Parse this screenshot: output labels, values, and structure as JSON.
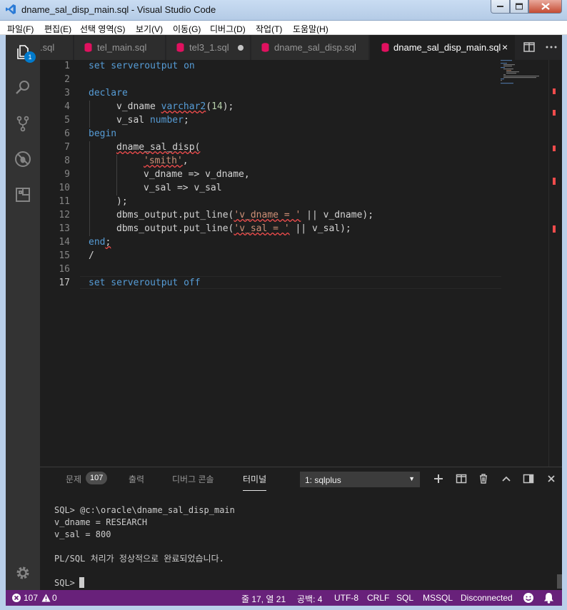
{
  "window": {
    "title": "dname_sal_disp_main.sql - Visual Studio Code"
  },
  "menu": [
    "파일(F)",
    "편집(E)",
    "선택 영역(S)",
    "보기(V)",
    "이동(G)",
    "디버그(D)",
    "작업(T)",
    "도움말(H)"
  ],
  "activity": {
    "explorer_badge": "1"
  },
  "tabs": [
    {
      "label": ".sql"
    },
    {
      "label": "tel_main.sql"
    },
    {
      "label": "tel3_1.sql",
      "dirty": true
    },
    {
      "label": "dname_sal_disp.sql"
    },
    {
      "label": "dname_sal_disp_main.sql",
      "active": true,
      "close": "×"
    }
  ],
  "editor": {
    "line_numbers": [
      "1",
      "2",
      "3",
      "4",
      "5",
      "6",
      "7",
      "8",
      "9",
      "10",
      "11",
      "12",
      "13",
      "14",
      "15",
      "16",
      "17"
    ],
    "lines": {
      "l1_a": "set serveroutput ",
      "l1_b": "on",
      "l3": "declare",
      "l4_a": "v_dname ",
      "l4_b": "varchar2",
      "l4_c": "(",
      "l4_d": "14",
      "l4_e": ");",
      "l5_a": "v_sal ",
      "l5_b": "number",
      "l5_c": ";",
      "l6": "begin",
      "l7": "dname_sal_disp(",
      "l8_a": "'smith'",
      "l8_b": ",",
      "l9": "v_dname => v_dname,",
      "l10": "v_sal => v_sal",
      "l11": ");",
      "l12_a": "dbms_output.put_line(",
      "l12_b": "'v_dname = '",
      "l12_c": " || v_dname);",
      "l13_a": "dbms_output.put_line(",
      "l13_b": "'v_sal = '",
      "l13_c": " || v_sal);",
      "l14_a": "end",
      "l14_b": ";",
      "l15": "/",
      "l17_a": "set serveroutput ",
      "l17_b": "off"
    }
  },
  "panel": {
    "tabs": {
      "problems": "문제",
      "problems_count": "107",
      "output": "출력",
      "debug_console": "디버그 콘솔",
      "terminal": "터미널"
    },
    "terminal_select": "1: sqlplus",
    "terminal_lines": {
      "t1": "SQL> @c:\\oracle\\dname_sal_disp_main",
      "t2": "v_dname = RESEARCH",
      "t3": "v_sal = 800",
      "t4": "PL/SQL 처리가 정상적으로 완료되었습니다.",
      "t5": "SQL>"
    }
  },
  "status": {
    "errors": "107",
    "warnings": "0",
    "position": "줄 17, 열 21",
    "indent": "공백: 4",
    "encoding": "UTF-8",
    "eol": "CRLF",
    "language": "SQL",
    "connection_type": "MSSQL",
    "connection": "Disconnected"
  },
  "colors": {
    "statusbar": "#68217a",
    "editor_bg": "#1e1e1e",
    "keyword": "#569cd6",
    "string": "#ce9178",
    "accent": "#007acc"
  }
}
